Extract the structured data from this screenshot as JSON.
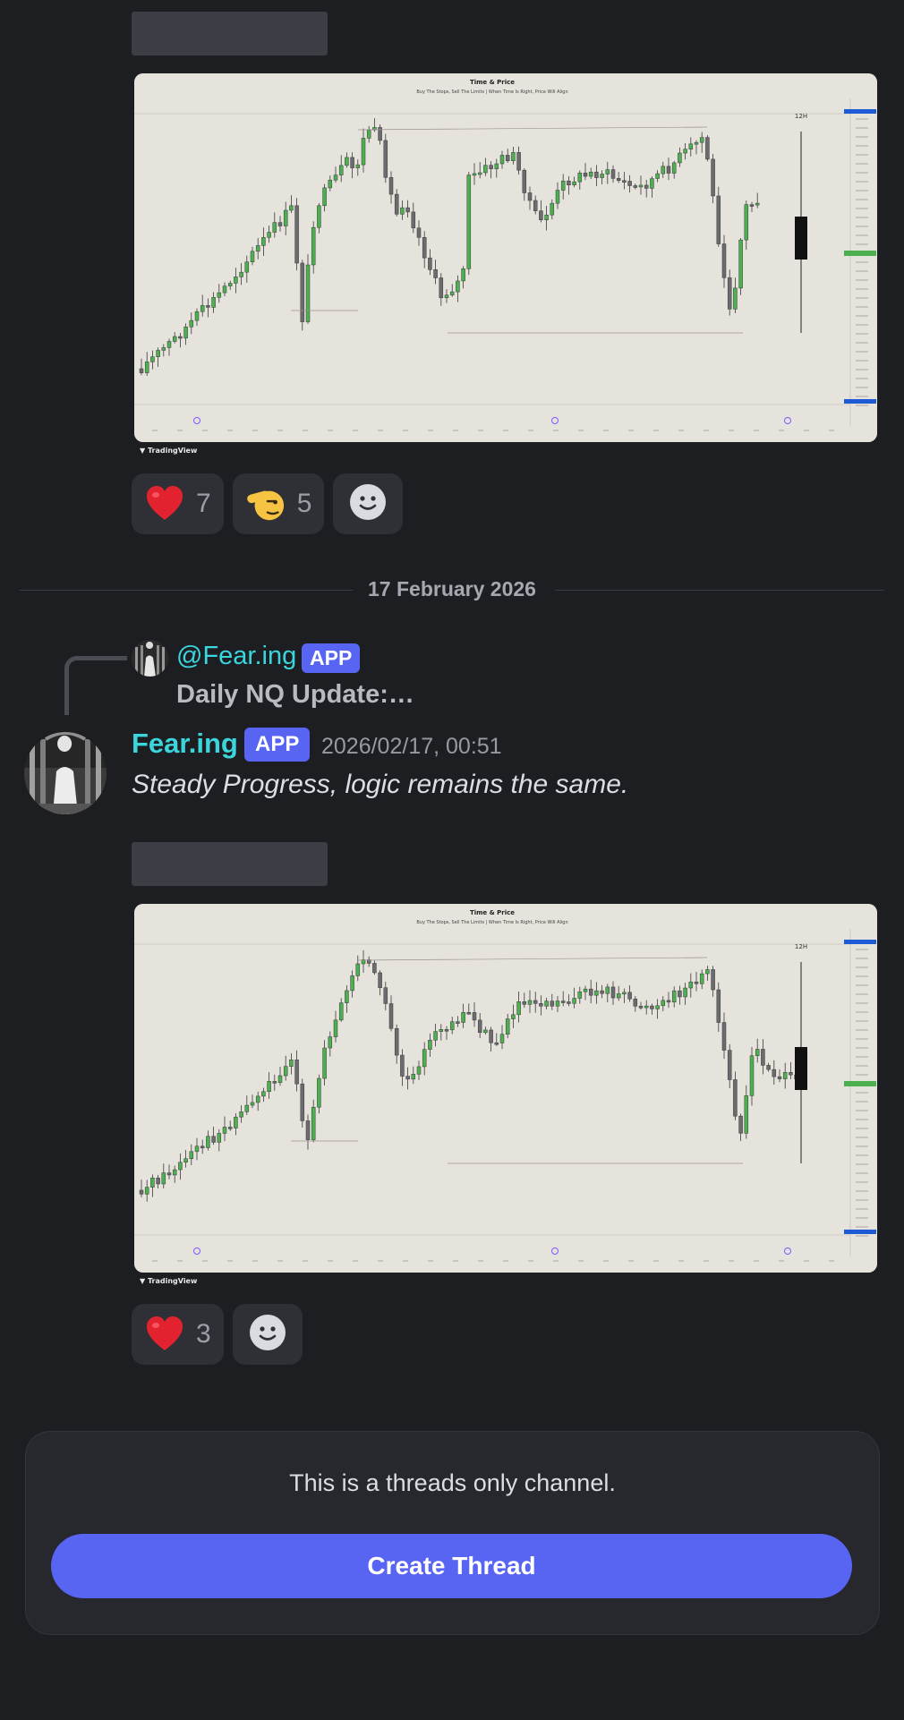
{
  "post1": {
    "reactions": [
      {
        "emoji": "heart-emoji",
        "count": "7"
      },
      {
        "emoji": "salute-emoji",
        "count": "5"
      }
    ]
  },
  "date_divider": "17 February 2026",
  "reply": {
    "mention": "@Fear.ing",
    "badge": "APP",
    "snippet": "Daily NQ Update:…"
  },
  "post2": {
    "author": "Fear.ing",
    "badge": "APP",
    "timestamp": "2026/02/17, 00:51",
    "message": "Steady Progress, logic remains the same.",
    "reactions": [
      {
        "emoji": "heart-emoji",
        "count": "3"
      }
    ]
  },
  "chart_embed": {
    "title": "Time & Price",
    "subtitle": "Buy The Stops, Sell The Limits | When Time Is Right, Price Will Align",
    "brand": "TradingView",
    "timeframe": "12H"
  },
  "footer": {
    "note": "This is a threads only channel.",
    "button": "Create Thread"
  },
  "colors": {
    "background": "#1d1e22",
    "accent": "#5865f2",
    "username": "#3bd5dc",
    "candle_up": "#4caf50",
    "candle_down": "#6b6b70"
  }
}
